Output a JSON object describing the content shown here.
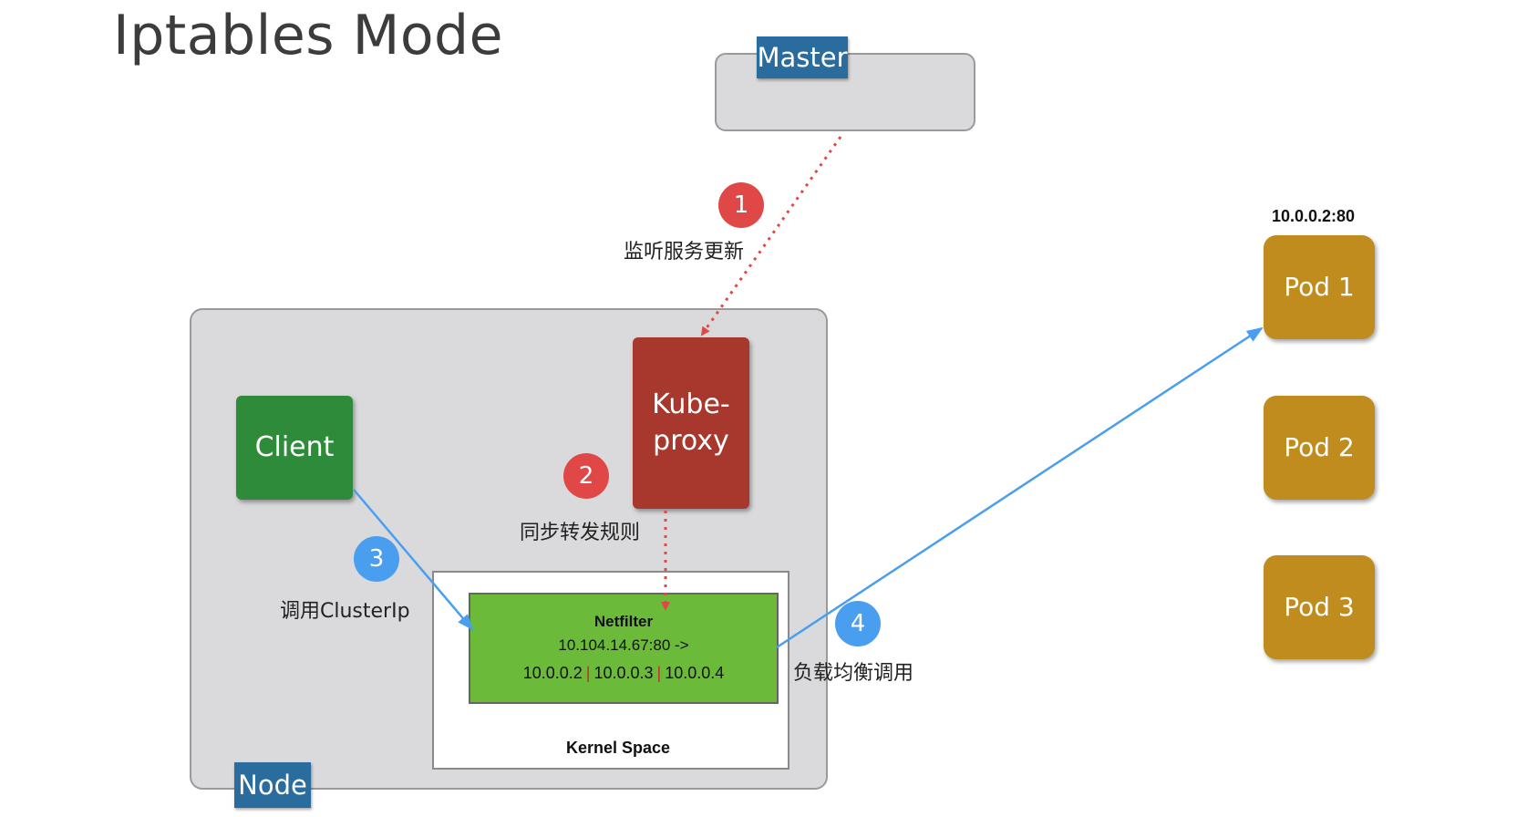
{
  "title": "Iptables Mode",
  "master": {
    "label": "Master"
  },
  "node": {
    "label": "Node",
    "client": "Client",
    "kube_proxy": "Kube-\nproxy",
    "kernel_space": {
      "label": "Kernel Space",
      "netfilter": {
        "title": "Netfilter",
        "rule": "10.104.14.67:80 ->",
        "targets": [
          "10.0.0.2",
          "10.0.0.3",
          "10.0.0.4"
        ],
        "separator": "|"
      }
    }
  },
  "pods": [
    {
      "label": "Pod 1",
      "address": "10.0.0.2:80"
    },
    {
      "label": "Pod 2"
    },
    {
      "label": "Pod 3"
    }
  ],
  "steps": [
    {
      "number": "1",
      "label": "监听服务更新",
      "color": "#e04848"
    },
    {
      "number": "2",
      "label": "同步转发规则",
      "color": "#e04848"
    },
    {
      "number": "3",
      "label": "调用ClusterIp",
      "color": "#4a9ef0"
    },
    {
      "number": "4",
      "label": "负载均衡调用",
      "color": "#4a9ef0"
    }
  ],
  "colors": {
    "client": "#2e8b3a",
    "kube_proxy": "#a8382e",
    "pod": "#c08c1e",
    "netfilter": "#6cba3a",
    "tag": "#2b6c9e",
    "red_arrow": "#e04848",
    "blue_arrow": "#4a9ef0"
  }
}
